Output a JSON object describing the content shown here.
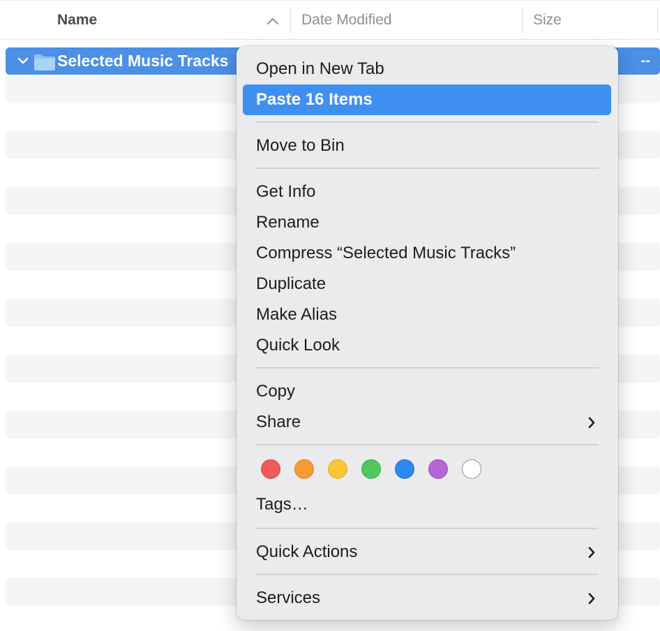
{
  "columns": {
    "name": "Name",
    "date_modified": "Date Modified",
    "size": "Size"
  },
  "selected_row": {
    "name": "Selected Music Tracks",
    "size": "--",
    "icon": "folder-icon",
    "expand_icon": "chevron-down-icon"
  },
  "menu": {
    "open_new_tab": "Open in New Tab",
    "paste": "Paste 16 Items",
    "move_to_bin": "Move to Bin",
    "get_info": "Get Info",
    "rename": "Rename",
    "compress": "Compress “Selected Music Tracks”",
    "duplicate": "Duplicate",
    "make_alias": "Make Alias",
    "quick_look": "Quick Look",
    "copy": "Copy",
    "share": "Share",
    "tags": "Tags…",
    "quick_actions": "Quick Actions",
    "services": "Services"
  },
  "tag_colors": [
    "#f05b5b",
    "#f59a35",
    "#f6c635",
    "#4fc75c",
    "#2f86f0",
    "#b565d6",
    "#ffffff"
  ],
  "colors": {
    "selection": "#4b8fe6",
    "menu_highlight": "#3f8ff0"
  }
}
